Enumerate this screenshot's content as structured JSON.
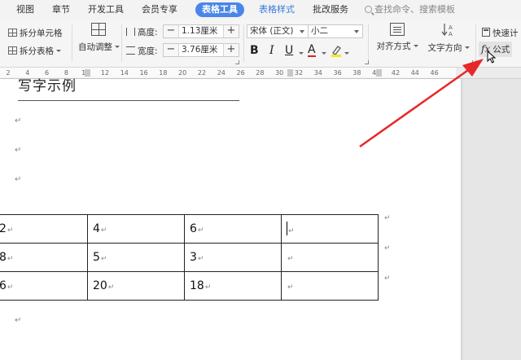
{
  "menubar": {
    "items": [
      "视图",
      "章节",
      "开发工具",
      "会员专享",
      "表格工具",
      "表格样式",
      "批改服务"
    ],
    "search_placeholder": "查找命令、搜索模板"
  },
  "ribbon": {
    "split_cell": "拆分单元格",
    "split_table": "拆分表格",
    "auto_fit": "自动调整",
    "height_label": "高度:",
    "height_value": "1.13厘米",
    "width_label": "宽度:",
    "width_value": "3.76厘米",
    "font_name": "宋体 (正文)",
    "font_size": "小二",
    "bold": "B",
    "italic": "I",
    "underline": "U",
    "font_color": "A",
    "align": "对齐方式",
    "text_direction": "文字方向",
    "quick_calc": "快速计",
    "formula": "公式",
    "formula_icon": "fx"
  },
  "ruler": {
    "ticks": [
      "2",
      "4",
      "6",
      "8",
      "10",
      "12",
      "14",
      "16",
      "18",
      "20",
      "22",
      "24",
      "26",
      "28",
      "30",
      "32",
      "34",
      "36",
      "38",
      "40",
      "42",
      "44",
      "46"
    ]
  },
  "document": {
    "heading": "写字示例",
    "paragraph_mark": "↵",
    "table": [
      [
        "2",
        "4",
        "6",
        ""
      ],
      [
        "8",
        "5",
        "3",
        ""
      ],
      [
        "6",
        "20",
        "18",
        ""
      ]
    ]
  },
  "colors": {
    "accent": "#4a86e8",
    "arrow": "#e8272a"
  }
}
